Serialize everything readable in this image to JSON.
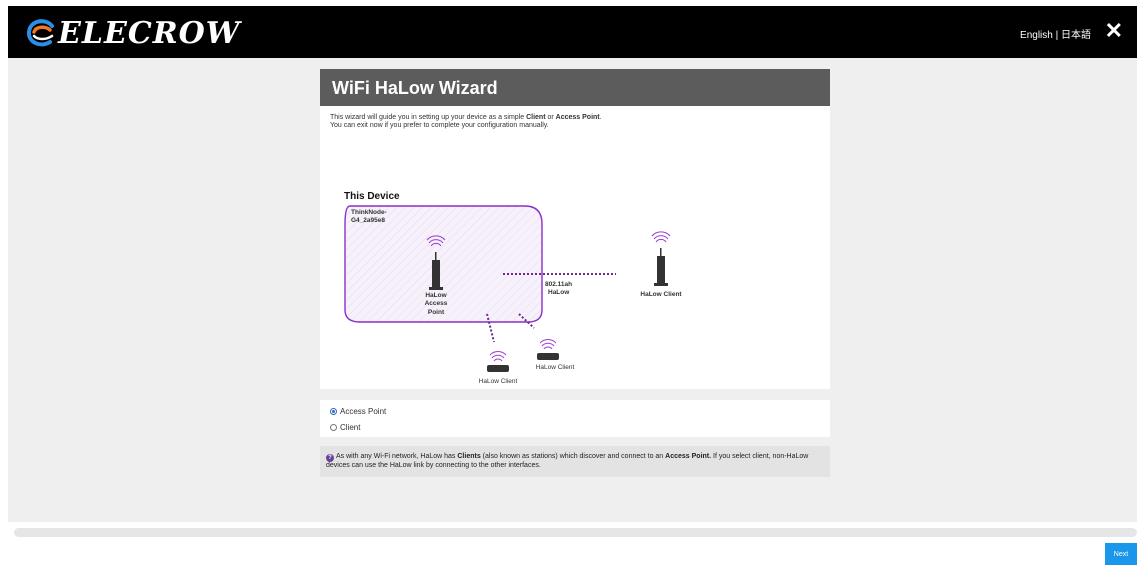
{
  "header": {
    "brand": "ELECROW",
    "language_options": "English | 日本語",
    "close_label": "✕"
  },
  "wizard": {
    "title": "WiFi HaLow Wizard",
    "intro_1_pre": "This wizard will guide you in setting up your device as a simple ",
    "intro_1_client": "Client",
    "intro_1_or": " or ",
    "intro_1_ap": "Access Point",
    "intro_1_end": ".",
    "intro_2": "You can exit now if you prefer to complete your configuration manually."
  },
  "diagram": {
    "this_device": "This Device",
    "device_name_1": "ThinkNode-",
    "device_name_2": "G4_2a95e8",
    "ap_label_1": "HaLow",
    "ap_label_2": "Access",
    "ap_label_3": "Point",
    "link_label_1": "802.11ah",
    "link_label_2": "HaLow",
    "client_right": "HaLow Client",
    "client_mid": "HaLow Client",
    "client_bottom": "HaLow Client",
    "accent_color": "#8b2fc9",
    "box_fill": "#f4eef9"
  },
  "mode": {
    "options": [
      "Access Point",
      "Client"
    ],
    "selected": "Access Point"
  },
  "info": {
    "icon": "question-icon",
    "t1": "As with any Wi-Fi network, HaLow has ",
    "clients": "Clients",
    "t2": " (also known as stations) which discover and connect to an ",
    "ap": "Access Point.",
    "t3": " If you select client, non-HaLow devices can use the HaLow link by connecting to the other interfaces."
  },
  "footer": {
    "next_label": "Next"
  }
}
